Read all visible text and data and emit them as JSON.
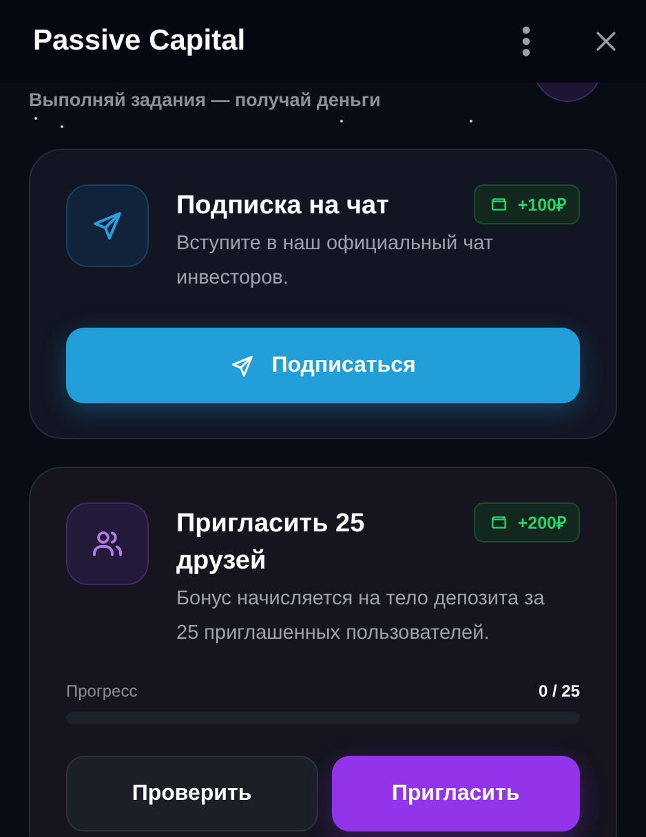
{
  "window": {
    "title": "Passive Capital"
  },
  "subtitle": "Выполняй задания — получай деньги",
  "tasks": [
    {
      "kind": "chat",
      "title": "Подписка на чат",
      "reward": "+100₽",
      "description": "Вступите в наш официальный чат инвесторов.",
      "buttons": [
        {
          "kind": "telegram",
          "label": "Подписаться"
        }
      ]
    },
    {
      "kind": "invite",
      "title": "Пригласить 25 друзей",
      "reward": "+200₽",
      "description": "Бонус начисляется на тело депозита за 25 приглашенных пользователей.",
      "progress": {
        "label": "Прогресс",
        "reading": "0 / 25",
        "level": 0
      },
      "buttons": [
        {
          "kind": "secondary",
          "label": "Проверить"
        },
        {
          "kind": "invite",
          "label": "Пригласить"
        }
      ]
    }
  ]
}
